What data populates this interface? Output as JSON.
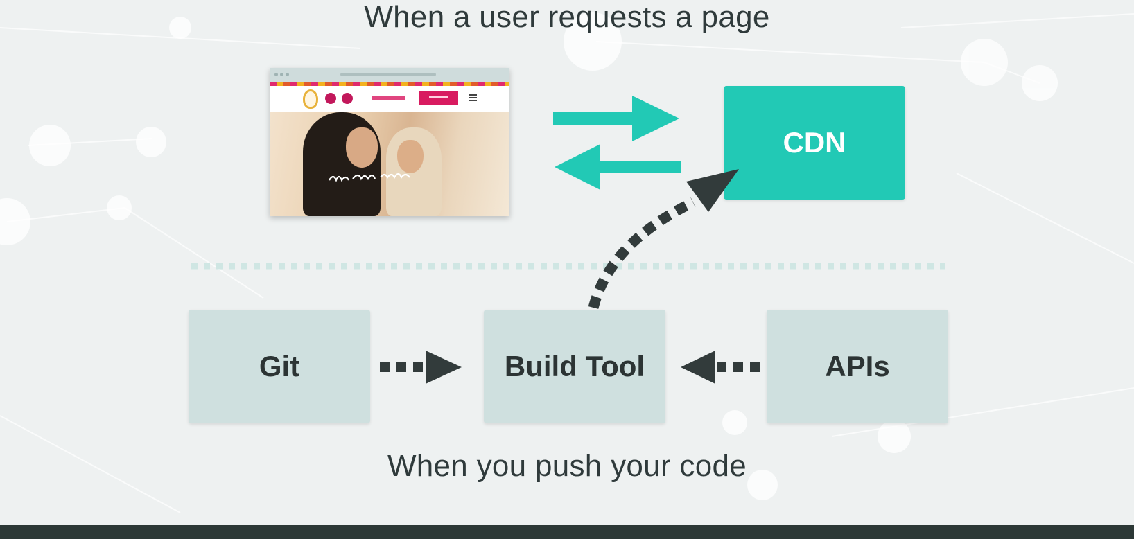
{
  "diagram": {
    "top_caption": "When a user requests a page",
    "bottom_caption": "When you push your code",
    "nodes": {
      "cdn": "CDN",
      "git": "Git",
      "build_tool": "Build Tool",
      "apis": "APIs"
    },
    "edges": [
      {
        "from": "browser",
        "to": "cdn",
        "style": "solid"
      },
      {
        "from": "cdn",
        "to": "browser",
        "style": "solid"
      },
      {
        "from": "git",
        "to": "build_tool",
        "style": "dotted"
      },
      {
        "from": "apis",
        "to": "build_tool",
        "style": "dotted"
      },
      {
        "from": "build_tool",
        "to": "cdn",
        "style": "dotted"
      }
    ]
  },
  "colors": {
    "background": "#eef1f1",
    "accent_teal": "#22c9b5",
    "box_light": "#cfe0df",
    "text_dark": "#2f3a3b",
    "dotted_arrow": "#323b3b",
    "divider": "#cfe6e3"
  },
  "icons": {
    "browser_screenshot": "website-preview-image"
  }
}
